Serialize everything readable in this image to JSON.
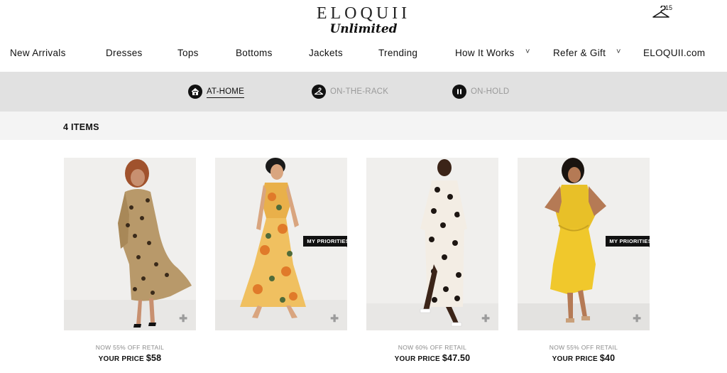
{
  "brand": {
    "name": "ELOQUII",
    "sub": "Unlimited"
  },
  "cart": {
    "count": "15",
    "icon": "hanger-icon"
  },
  "nav": [
    {
      "label": "New Arrivals"
    },
    {
      "label": "Dresses"
    },
    {
      "label": "Tops"
    },
    {
      "label": "Bottoms"
    },
    {
      "label": "Jackets"
    },
    {
      "label": "Trending"
    },
    {
      "label": "How It Works",
      "caret": "˅"
    },
    {
      "label": "Refer & Gift",
      "caret": "˅"
    },
    {
      "label": "ELOQUII.com"
    }
  ],
  "tabs": [
    {
      "label": "AT-HOME",
      "icon": "home-icon",
      "active": true
    },
    {
      "label": "ON-THE-RACK",
      "icon": "hanger-icon",
      "active": false
    },
    {
      "label": "ON-HOLD",
      "icon": "pause-icon",
      "active": false
    }
  ],
  "items_count": "4 ITEMS",
  "products": [
    {
      "discount": "NOW 55% OFF RETAIL",
      "price_label": "YOUR PRICE",
      "price": "$58",
      "badge": "",
      "image": "leopard print wrap maxi dress"
    },
    {
      "discount": "",
      "price_label": "",
      "price": "",
      "badge": "MY PRIORITIES",
      "image": "floral print sleeveless maxi dress"
    },
    {
      "discount": "NOW 60% OFF RETAIL",
      "price_label": "YOUR PRICE",
      "price": "$47.50",
      "badge": "",
      "image": "black and white print slit maxi dress"
    },
    {
      "discount": "NOW 55% OFF RETAIL",
      "price_label": "YOUR PRICE",
      "price": "$40",
      "badge": "MY PRIORITIES",
      "image": "yellow twist-front midi dress"
    }
  ],
  "colors": {
    "tabbar_bg": "#e1e1e1",
    "countbar_bg": "#f4f4f4",
    "accent": "#111111"
  }
}
